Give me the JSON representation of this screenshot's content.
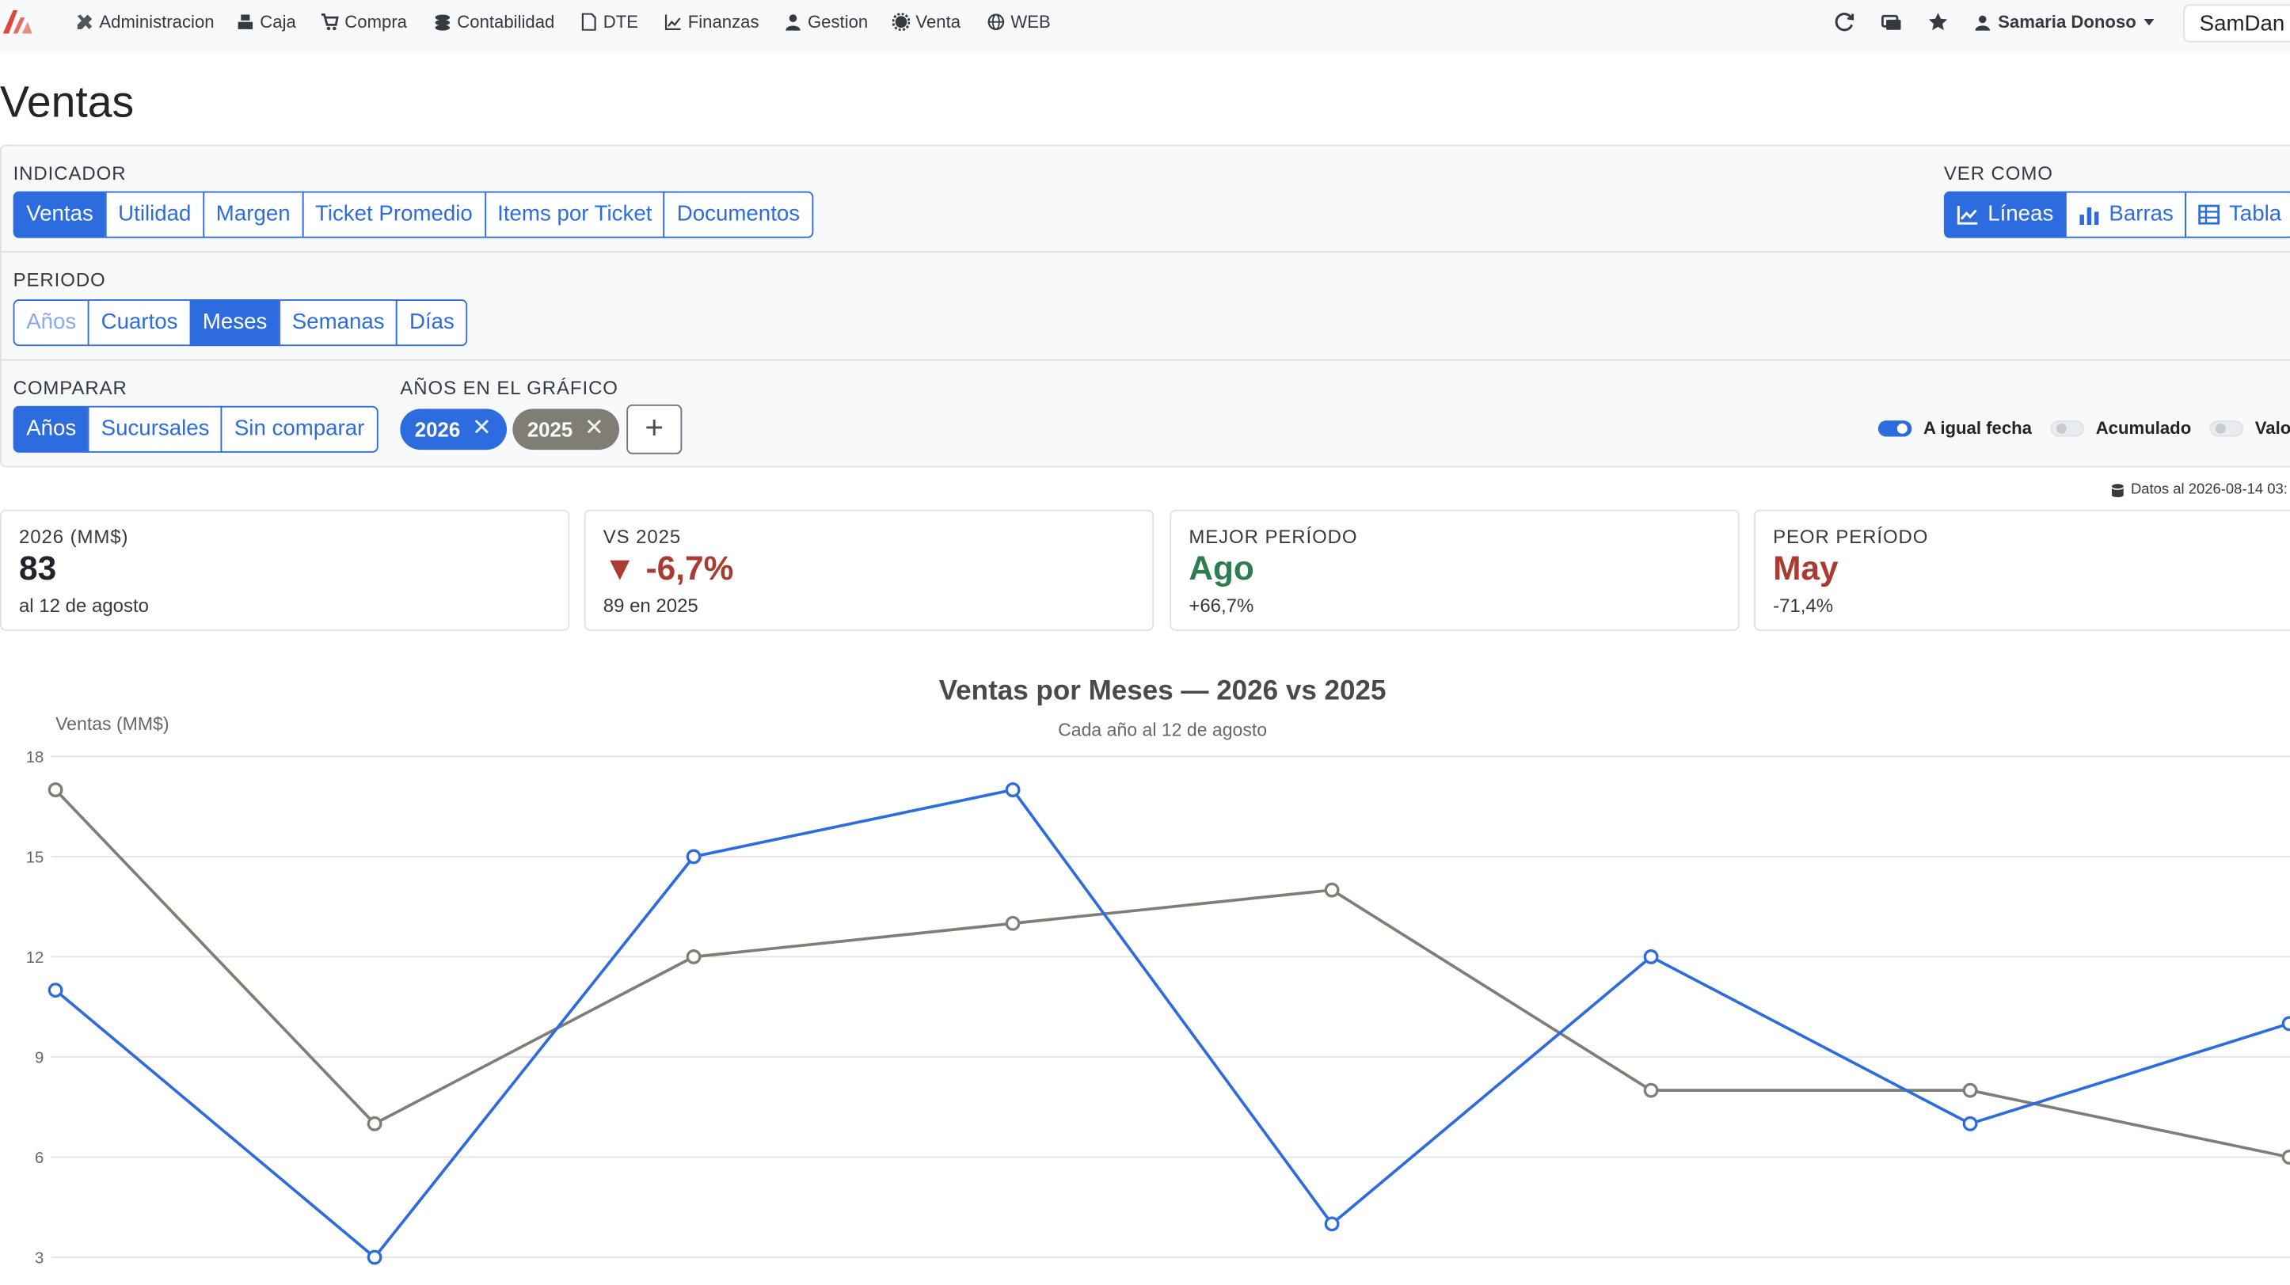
{
  "nav": {
    "items": [
      {
        "label": "Administracion",
        "icon": "tools-icon"
      },
      {
        "label": "Caja",
        "icon": "register-icon"
      },
      {
        "label": "Compra",
        "icon": "cart-icon"
      },
      {
        "label": "Contabilidad",
        "icon": "coins-icon"
      },
      {
        "label": "DTE",
        "icon": "file-icon"
      },
      {
        "label": "Finanzas",
        "icon": "chart-line-icon"
      },
      {
        "label": "Gestion",
        "icon": "user-tie-icon"
      },
      {
        "label": "Venta",
        "icon": "gear-icon"
      },
      {
        "label": "WEB",
        "icon": "globe-icon"
      }
    ],
    "user": "Samaria Donoso",
    "company": "SamDan"
  },
  "page": {
    "title": "Ventas"
  },
  "filters": {
    "indicador_label": "INDICADOR",
    "indicadores": [
      "Ventas",
      "Utilidad",
      "Margen",
      "Ticket Promedio",
      "Items por Ticket",
      "Documentos"
    ],
    "indicador_active": "Ventas",
    "ver_como_label": "VER COMO",
    "ver_como": [
      "Líneas",
      "Barras",
      "Tabla"
    ],
    "ver_como_active": "Líneas",
    "periodo_label": "PERIODO",
    "periodos": [
      "Años",
      "Cuartos",
      "Meses",
      "Semanas",
      "Días"
    ],
    "periodo_active": "Meses",
    "comparar_label": "COMPARAR",
    "comparar": [
      "Años",
      "Sucursales",
      "Sin comparar"
    ],
    "comparar_active": "Años",
    "anios_label": "AÑOS EN EL GRÁFICO",
    "anios": [
      {
        "year": "2026",
        "color": "#2d6cdf"
      },
      {
        "year": "2025",
        "color": "#7f7d74"
      }
    ],
    "add_label": "+",
    "toggles": [
      {
        "label": "A igual fecha",
        "on": true
      },
      {
        "label": "Acumulado",
        "on": false
      },
      {
        "label": "Valor",
        "on": false
      }
    ]
  },
  "asof": "Datos al 2026-08-14 03:",
  "cards": [
    {
      "label": "2026 (MM$)",
      "value": "83",
      "sub": "al 12 de agosto",
      "color": "#212529"
    },
    {
      "label": "VS 2025",
      "value": "▼ -6,7%",
      "sub": "89 en 2025",
      "color": "#a83b32"
    },
    {
      "label": "MEJOR PERÍODO",
      "value": "Ago",
      "sub": "+66,7%",
      "color": "#2e7d4f"
    },
    {
      "label": "PEOR PERÍODO",
      "value": "May",
      "sub": "-71,4%",
      "color": "#a83b32"
    }
  ],
  "chart_data": {
    "type": "line",
    "title": "Ventas por Meses — 2026 vs 2025",
    "subtitle": "Cada año al 12 de agosto",
    "ylabel": "Ventas (MM$)",
    "xlabel": "",
    "ylim": [
      3,
      18
    ],
    "yticks": [
      3,
      6,
      9,
      12,
      15,
      18
    ],
    "grid": true,
    "x": [
      1,
      2,
      3,
      4,
      5,
      6,
      7,
      8
    ],
    "series": [
      {
        "name": "2025",
        "color": "#7f7d74",
        "values": [
          17,
          7,
          12,
          13,
          14,
          8,
          8,
          6
        ]
      },
      {
        "name": "2026",
        "color": "#2d6cdf",
        "values": [
          11,
          3,
          15,
          17,
          4,
          12,
          7,
          10
        ]
      }
    ]
  }
}
